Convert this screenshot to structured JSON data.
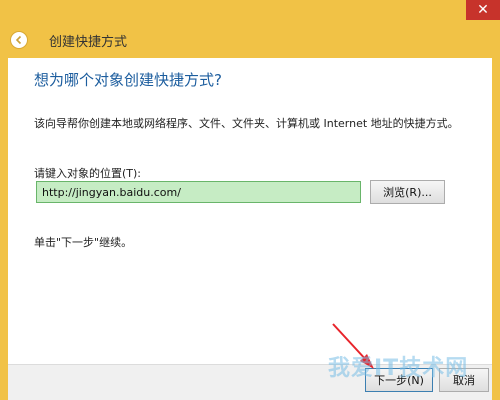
{
  "window": {
    "close_glyph": "✕"
  },
  "wizard": {
    "title": "创建快捷方式",
    "heading": "想为哪个对象创建快捷方式?",
    "description": "该向导帮你创建本地或网络程序、文件、文件夹、计算机或 Internet 地址的快捷方式。",
    "location_label": "请键入对象的位置(T):",
    "location_value": "http://jingyan.baidu.com/",
    "browse_label": "浏览(R)...",
    "hint": "单击\"下一步\"继续。"
  },
  "footer": {
    "next_label": "下一步(N)",
    "cancel_label": "取消"
  },
  "watermark": {
    "text": "我爱IT技术网"
  },
  "colors": {
    "window_frame": "#f1c246",
    "heading": "#1c5d9e",
    "input_bg": "#c6ecc4",
    "close_button": "#c7332b",
    "annotation_arrow": "#e8242b"
  },
  "icons": {
    "back": "back-arrow-icon",
    "close": "close-icon",
    "annotation": "red-arrow-annotation"
  }
}
